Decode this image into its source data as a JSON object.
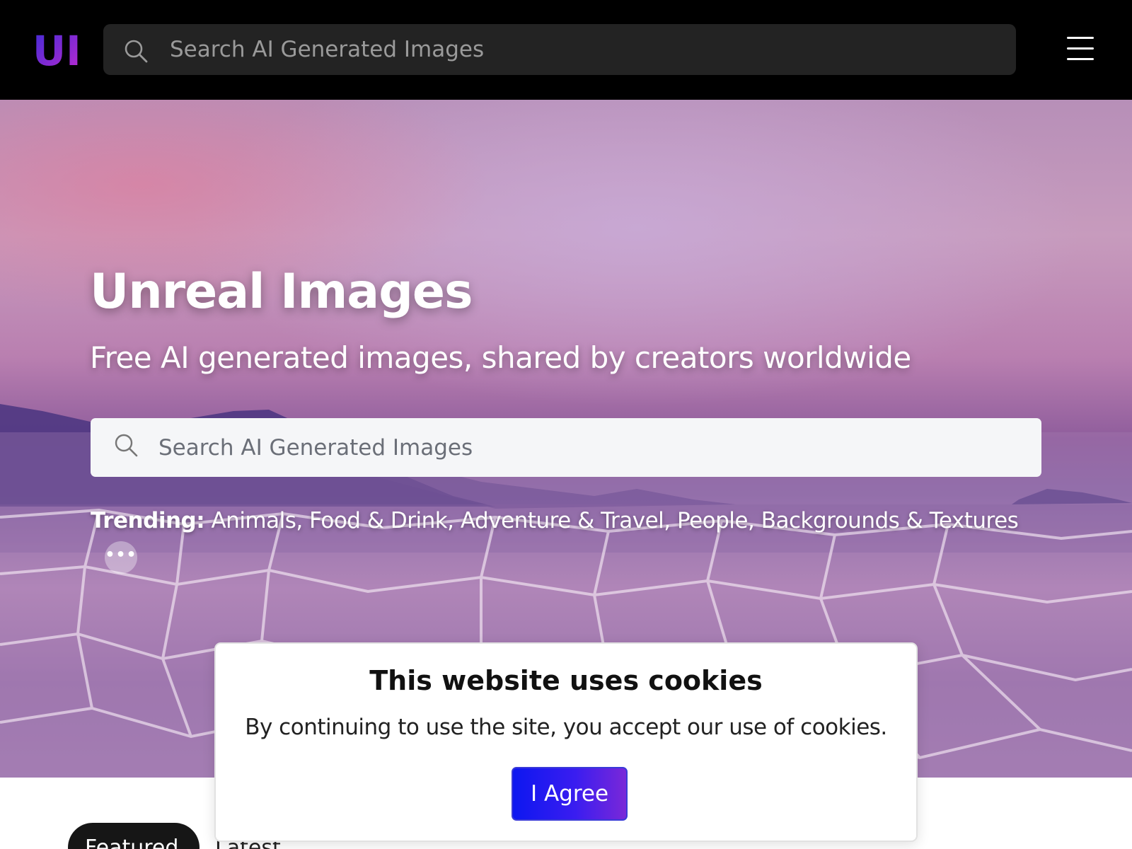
{
  "navbar": {
    "logo_text": "UI",
    "search_placeholder": "Search AI Generated Images",
    "menu_icon": "hamburger-menu-icon"
  },
  "hero": {
    "title": "Unreal Images",
    "subtitle": "Free AI generated images, shared by creators worldwide",
    "search_placeholder": "Search AI Generated Images",
    "trending_label": "Trending:",
    "trending_items": [
      "Animals",
      "Food & Drink",
      "Adventure & Travel",
      "People",
      "Backgrounds & Textures"
    ],
    "more_label": "•••"
  },
  "tabs": [
    {
      "label": "Featured",
      "active": true
    },
    {
      "label": "Latest",
      "active": false
    }
  ],
  "cookie_banner": {
    "title": "This website uses cookies",
    "message": "By continuing to use the site, you accept our use of cookies.",
    "agree_label": "I Agree"
  },
  "colors": {
    "navbar_bg": "#000000",
    "logo_gradient_start": "#3d2bd6",
    "logo_gradient_end": "#c02ad0",
    "agree_gradient_start": "#0d17f0",
    "agree_gradient_end": "#7a28d8"
  }
}
